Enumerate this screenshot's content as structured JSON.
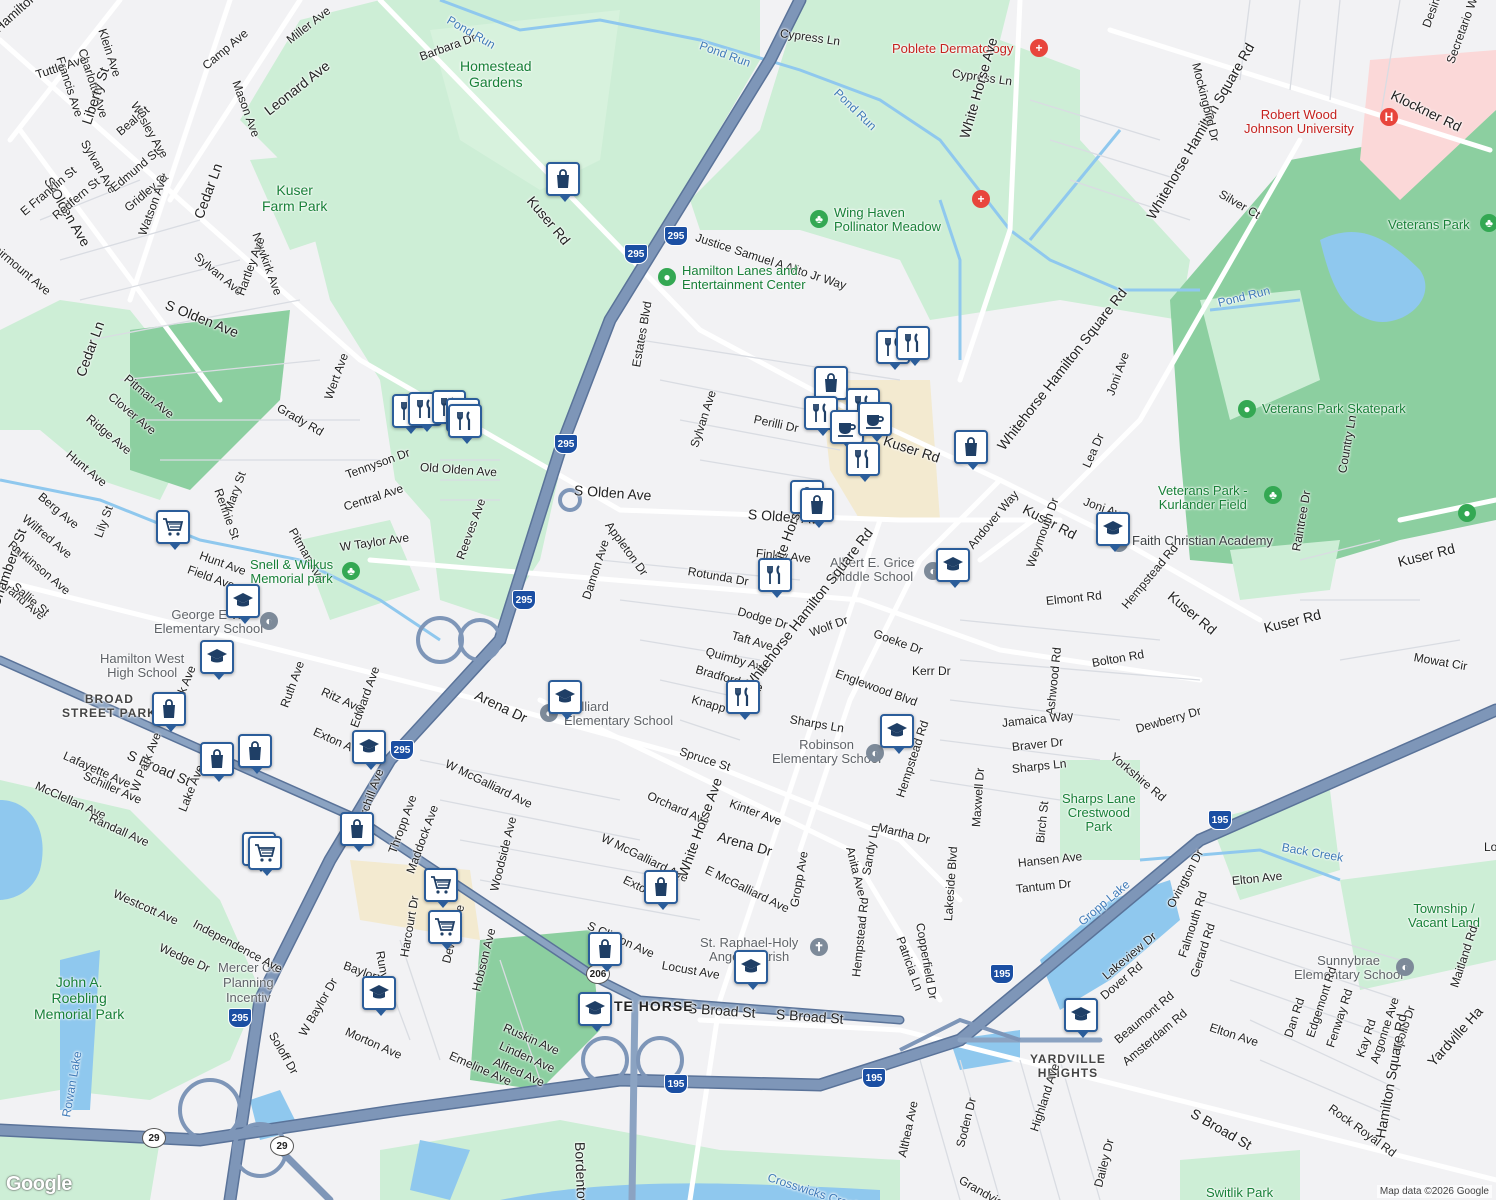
{
  "colors": {
    "land": "#f2f2f4",
    "park": "#cdeed6",
    "park_dark": "#8ccfa0",
    "water": "#8fc8ee",
    "highway": "#7e96b8",
    "highway_edge": "#5a7399",
    "road": "#ffffff",
    "road_edge": "#d2d6de",
    "hospital": "#fbd8d8",
    "school": "#f3ead0",
    "pin_border": "#2b5d9a",
    "pin_icon": "#1f3f66"
  },
  "labels": {
    "hamilton_ave": "Hamilton Ave",
    "klein_ave": "Klein Ave",
    "charlotte_ave": "Charlotte Ave",
    "francis_ave": "Francis Ave",
    "tuttle_ave": "Tuttle Ave",
    "liberty_st": "Liberty St",
    "wesley_ave": "Wesley Ave",
    "camp_ave": "Camp Ave",
    "mason_ave": "Mason Ave",
    "miller_ave": "Miller Ave",
    "barbara_dr": "Barbara Dr",
    "leonard_ave": "Leonard Ave",
    "sylvan_ave_w": "Sylvan Ave",
    "beal_st": "Beal St",
    "edmund_st": "Edmund St",
    "gridley_st": "Gridley St",
    "s_olden_ave_nw": "S Olden Ave",
    "e_franklin_st": "E Franklin St",
    "redfern_st": "Redfern St",
    "fairmount_ave": "Fairmount Ave",
    "watson_ave": "Watson Ave",
    "cedar_ln": "Cedar Ln",
    "sylvan_ave_2": "Sylvan Ave",
    "newkirk_ave": "Newkirk Ave",
    "hartley_ave": "Hartley Ave",
    "s_olden_ave_w": "S Olden Ave",
    "cedar_ln_2": "Cedar Ln",
    "pitman_ave": "Pitman Ave",
    "clover_ave": "Clover Ave",
    "ridge_ave": "Ridge Ave",
    "grady_rd": "Grady Rd",
    "wert_ave": "Wert Ave",
    "hunt_ave": "Hunt Ave",
    "berg_ave": "Berg Ave",
    "wilfred_ave": "Wilfred Ave",
    "parkinson_ave": "Parkinson Ave",
    "grand_ave": "Grand Ave",
    "sallie_st": "Sallie St",
    "chambers_st": "Chambers St",
    "lily_st": "Lily St",
    "rennie_st": "Rennie St",
    "mary_st": "Mary St",
    "hunt_ave_2": "Hunt Ave",
    "field_ave": "Field Ave",
    "tennyson_dr": "Tennyson Dr",
    "old_olden_ave": "Old Olden Ave",
    "central_ave": "Central Ave",
    "w_taylor_ave": "W Taylor Ave",
    "pitman_ave_2": "Pitman Ave",
    "reeves_ave": "Reeves Ave",
    "kuser_rd_nw": "Kuser Rd",
    "pond_run_1": "Pond Run",
    "pond_run_2": "Pond Run",
    "pond_run_3": "Pond Run",
    "pond_run_4": "Pond Run",
    "homestead_gardens": "Homestead\nGardens",
    "kuser_farm_park": "Kuser\nFarm Park",
    "cypress_ln_1": "Cypress Ln",
    "cypress_ln_2": "Cypress Ln",
    "poblete": "Poblete Dermatology",
    "white_horse_ave_n": "White Horse Ave",
    "justice_alito": "Justice Samuel A Alito Jr Way",
    "wing_haven": "Wing Haven\nPollinator Meadow",
    "hamilton_lanes": "Hamilton Lanes and\nEntertainment Center",
    "estates_blvd": "Estates Blvd",
    "perilli_dr": "Perilli Dr",
    "sylvan_ave_c": "Sylvan Ave",
    "kuser_rd_c": "Kuser Rd",
    "s_olden_ave_c": "S Olden Ave",
    "s_olden_ave_c2": "S Olden Av",
    "appleton_dr": "Appleton Dr",
    "finley_ave": "Finley Ave",
    "rotunda_dr": "Rotunda Dr",
    "damon_ave": "Damon Ave",
    "dodge_dr": "Dodge Dr",
    "white_horse_ave_c": "White Horse Ave",
    "taft_ave": "Taft Ave",
    "quimby_ave": "Quimby Ave",
    "bradford_ave": "Bradford Ave",
    "knapp": "Knapp",
    "wolf_dr": "Wolf Dr",
    "grice": "Albert E. Grice\nMiddle School",
    "andover_way": "Andover Way",
    "whitehorse_hamilton_sq_rd": "Whitehorse Hamilton Square Rd",
    "whitehorse_hamilton_sq_rd_2": "Whitehorse Hamilton Square Rd",
    "whitehorse_hamilton_sq_rd_3": "Whitehorse Hamilton Square Rd",
    "goeke_dr": "Goeke Dr",
    "englewood_blvd": "Englewood Blvd",
    "kerr_dr": "Kerr Dr",
    "sharps_ln": "Sharps Ln",
    "robinson": "Robinson\nElementary School",
    "spruce_st": "Spruce St",
    "arena_dr": "Arena Dr",
    "arena_dr_2": "Arena Dr",
    "galliard": "Galliard\nElementary School",
    "w_mcgalliard_ave": "W McGalliard Ave",
    "w_mcgalliard_ave_2": "W McGalliard Ave",
    "e_mcgalliard_ave": "E McGalliard Ave",
    "orchard_ave": "Orchard Ave",
    "kinter_ave": "Kinter Ave",
    "martha_dr": "Martha Dr",
    "anita_ave": "Anita Ave",
    "sandy_ln": "Sandy Ln",
    "hempstead_rd_c": "Hempstead Rd",
    "white_horse_ave_s": "White Horse Ave",
    "gropp_ave": "Gropp Ave",
    "hempstead_rd_s": "Hempstead Rd",
    "patricia_ln": "Patricia Ln",
    "copperfield_dr": "Copperfield Dr",
    "st_raphael": "St. Raphael-Holy\nAngels Parish",
    "exton_ave": "Exton",
    "s_clinton_ave": "S Clinton Ave",
    "locust_ave": "Locust Ave",
    "s_broad_st_c": "S Broad St",
    "s_broad_st_c2": "S Broad St",
    "white_horse_s": "TE HORSE",
    "churchill_ave": "Churchill Ave",
    "thropp_ave": "Thropp Ave",
    "maddock_ave": "Maddock Ave",
    "woodside_ave": "Woodside Ave",
    "hobson_ave": "Hobson Ave",
    "dewey_ave": "Dewey Ave",
    "harcourt_dr": "Harcourt Dr",
    "runyon_dr": "Runyon Dr",
    "baylor": "Baylor",
    "w_baylor_dr": "W Baylor Dr",
    "soloff_dr": "Soloff Dr",
    "morton_ave": "Morton Ave",
    "emeline_ave": "Emeline Ave",
    "ruskin_ave": "Ruskin Ave",
    "linden_ave": "Linden Ave",
    "alfred_ave": "Alfred Ave",
    "bordentown_rd": "Bordentown Rd",
    "mercer_co": "Mercer Co\nPlanning\nIncentiv",
    "roebling": "John A.\nRoebling\nMemorial Park",
    "rowan_lake": "Rowan Lake",
    "snell_wilkus": "Snell & Wilkus\nMemorial park",
    "george_e_wilson": "George E Wi\nElementary School",
    "hamilton_west": "Hamilton West\nHigh School",
    "broad_street_park": "BROAD\nSTREET PARK",
    "s_broad_st_w": "S Broad St",
    "lafayette_ave": "Lafayette Ave",
    "schiller_ave": "Schiller Ave",
    "mcclellan_ave": "McClellan Ave",
    "randall_ave": "Randall Ave",
    "w_park_ave": "W Park Ave",
    "e_park_ave": "E Park Ave",
    "lake_ave": "Lake Ave",
    "westcott_ave": "Westcott Ave",
    "wedge_dr": "Wedge Dr",
    "independence_ave": "Independence Ave",
    "ruth_ave": "Ruth Ave",
    "ritz_ave": "Ritz Ave",
    "edward_ave": "Edward Ave",
    "exton_ave_w": "Exton Av",
    "arena_dr_w": "Arena Dr",
    "robert_wood": "Robert Wood\nJohnson University",
    "klockner_rd": "Klockner Rd",
    "mockingbird_dr": "Mockingbird Dr",
    "silver_ct": "Silver Ct",
    "secretario_way": "Secretario Way",
    "desiree_dr": "Desiree Dr",
    "veterans_park": "Veterans Park",
    "veterans_skatepark": "Veterans Park Skatepark",
    "veterans_kurlander": "Veterans Park -\nKurlander Field",
    "pond_run_e": "Pond Run",
    "joni_ave": "Joni Ave",
    "joni_ave_2": "Joni Ave",
    "lea_dr": "Lea Dr",
    "kuser_rd_e": "Kuser Rd",
    "kuser_rd_e2": "Kuser Rd",
    "kuser_rd_e3": "Kuser Rd",
    "kuser_rd_e4": "Kuser Rd",
    "faith_christian": "Faith Christian Academy",
    "weymouth_dr": "Weymouth Dr",
    "elmont_rd": "Elmont Rd",
    "hempstead_rd_e": "Hempstead Rd",
    "country_ln": "Country Ln",
    "raintree_dr": "Raintree Dr",
    "bolton_rd": "Bolton Rd",
    "mowat_cir": "Mowat Cir",
    "ashwood_rd": "Ashwood Rd",
    "jamaica_way": "Jamaica Way",
    "dewberry_dr": "Dewberry Dr",
    "braver_dr": "Braver Dr",
    "yorkshire_rd": "Yorkshire Rd",
    "sharps_ln_e": "Sharps Ln",
    "sharps_lane_park": "Sharps Lane\nCrestwood\nPark",
    "maxwell_dr": "Maxwell Dr",
    "birch_st": "Birch St",
    "hansen_ave": "Hansen Ave",
    "tantum_dr": "Tantum Dr",
    "lakeside_blvd": "Lakeside Blvd",
    "back_creek": "Back Creek",
    "elton_ave": "Elton Ave",
    "elton_ave_2": "Elton Ave",
    "ovington_dr": "Ovington Dr",
    "gropp_lake": "Gropp Lake",
    "lakeview_dr": "Lakeview Dr",
    "dover_rd": "Dover Rd",
    "falmouth_rd": "Falmouth Rd",
    "gerard_rd": "Gerard Rd",
    "beaumont_rd": "Beaumont Rd",
    "amsterdam_rd": "Amsterdam Rd",
    "township_vacant": "Township /\nVacant Land",
    "sunnybrae": "Sunnybrae\nElementary School",
    "dan_rd": "Dan Rd",
    "edgemont_rd": "Edgemont Rd",
    "fenway_rd": "Fenway Rd",
    "kay_rd": "Kay Rd",
    "argonne_ave": "Argonne Ave",
    "apollo_dr": "Apollo Dr",
    "rock_royal_rd": "Rock Royal Rd",
    "hamilton_sq_rd_se": "Hamilton Square Rd",
    "yardville_hamilton": "Yardville Ha",
    "maitland_rd": "Maitland Rd",
    "yardville_heights": "YARDVILLE\nHEIGHTS",
    "s_broad_st_se": "S Broad St",
    "highland_ave": "Highland Ave",
    "soden_dr": "Soden Dr",
    "althea_ave": "Althea Ave",
    "grandview_ave": "Grandview Ave",
    "dailey_dr": "Dailey Dr",
    "crosswicks_creek": "Crosswicks Creek",
    "switlik_park": "Switlik Park",
    "lo": "Lo"
  },
  "shields": {
    "i295_a": "295",
    "i295_b": "295",
    "i295_c": "295",
    "i295_d": "295",
    "i295_e": "295",
    "i295_f": "295",
    "i195_a": "195",
    "i195_b": "195",
    "i195_c": "195",
    "i195_d": "195",
    "us206": "206",
    "nj29_a": "29",
    "nj29_b": "29"
  },
  "pins": [
    {
      "type": "shopping",
      "icon": "shopping-bag-icon"
    },
    {
      "type": "restaurant",
      "icon": "fork-knife-icon"
    },
    {
      "type": "restaurant",
      "icon": "fork-knife-icon"
    },
    {
      "type": "shopping",
      "icon": "shopping-bag-icon"
    },
    {
      "type": "restaurant",
      "icon": "fork-knife-icon"
    },
    {
      "type": "restaurant",
      "icon": "fork-knife-icon"
    },
    {
      "type": "cafe",
      "icon": "coffee-cup-icon"
    },
    {
      "type": "cafe",
      "icon": "coffee-cup-icon"
    },
    {
      "type": "restaurant",
      "icon": "fork-knife-icon"
    },
    {
      "type": "shopping",
      "icon": "shopping-bag-icon"
    },
    {
      "type": "shopping",
      "icon": "shopping-bag-icon"
    },
    {
      "type": "shopping",
      "icon": "shopping-bag-icon"
    },
    {
      "type": "restaurant",
      "icon": "fork-knife-icon"
    },
    {
      "type": "school",
      "icon": "school-cap-icon"
    },
    {
      "type": "school",
      "icon": "school-cap-icon"
    },
    {
      "type": "restaurant",
      "icon": "fork-knife-icon"
    },
    {
      "type": "school",
      "icon": "school-cap-icon"
    },
    {
      "type": "school",
      "icon": "school-cap-icon"
    },
    {
      "type": "restaurant",
      "icon": "fork-knife-icon"
    },
    {
      "type": "restaurant",
      "icon": "fork-knife-icon"
    },
    {
      "type": "restaurant",
      "icon": "fork-knife-icon"
    },
    {
      "type": "restaurant",
      "icon": "fork-knife-icon"
    },
    {
      "type": "restaurant",
      "icon": "fork-knife-icon"
    },
    {
      "type": "grocery",
      "icon": "shopping-cart-icon"
    },
    {
      "type": "school",
      "icon": "school-cap-icon"
    },
    {
      "type": "school",
      "icon": "school-cap-icon"
    },
    {
      "type": "shopping",
      "icon": "shopping-bag-icon"
    },
    {
      "type": "shopping",
      "icon": "shopping-bag-icon"
    },
    {
      "type": "shopping",
      "icon": "shopping-bag-icon"
    },
    {
      "type": "school",
      "icon": "school-cap-icon"
    },
    {
      "type": "shopping",
      "icon": "shopping-bag-icon"
    },
    {
      "type": "grocery",
      "icon": "shopping-cart-icon"
    },
    {
      "type": "grocery",
      "icon": "shopping-cart-icon"
    },
    {
      "type": "grocery",
      "icon": "shopping-cart-icon"
    },
    {
      "type": "grocery",
      "icon": "shopping-cart-icon"
    },
    {
      "type": "shopping",
      "icon": "shopping-bag-icon"
    },
    {
      "type": "shopping",
      "icon": "shopping-bag-icon"
    },
    {
      "type": "school",
      "icon": "school-cap-icon"
    },
    {
      "type": "school",
      "icon": "school-cap-icon"
    },
    {
      "type": "school",
      "icon": "school-cap-icon"
    },
    {
      "type": "school",
      "icon": "school-cap-icon"
    }
  ],
  "logo": "Google",
  "attribution": "Map data ©2026 Google"
}
